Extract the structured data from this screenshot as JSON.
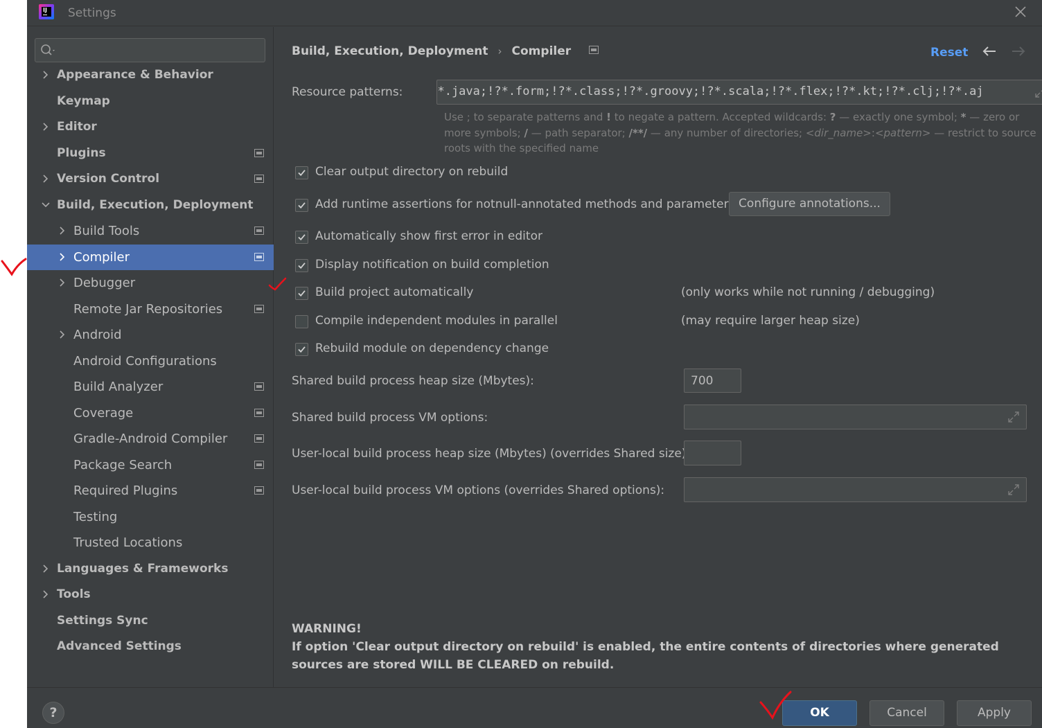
{
  "window": {
    "title": "Settings",
    "app_icon": "intellij-idea-icon",
    "app_icon_text": "IJ"
  },
  "sidebar": {
    "search": {
      "value": "",
      "placeholder": ""
    },
    "items": [
      {
        "label": "Appearance & Behavior",
        "bold": true,
        "expandable": true,
        "expanded": false,
        "project_icon": false
      },
      {
        "label": "Keymap",
        "bold": true,
        "expandable": false,
        "project_icon": false
      },
      {
        "label": "Editor",
        "bold": true,
        "expandable": true,
        "expanded": false,
        "project_icon": false
      },
      {
        "label": "Plugins",
        "bold": true,
        "expandable": false,
        "project_icon": true
      },
      {
        "label": "Version Control",
        "bold": true,
        "expandable": true,
        "expanded": false,
        "project_icon": true
      },
      {
        "label": "Build, Execution, Deployment",
        "bold": true,
        "expandable": true,
        "expanded": true,
        "project_icon": false
      },
      {
        "label": "Build Tools",
        "bold": false,
        "expandable": true,
        "expanded": false,
        "project_icon": true
      },
      {
        "label": "Compiler",
        "bold": false,
        "expandable": true,
        "expanded": false,
        "project_icon": true,
        "selected": true
      },
      {
        "label": "Debugger",
        "bold": false,
        "expandable": true,
        "expanded": false,
        "project_icon": false
      },
      {
        "label": "Remote Jar Repositories",
        "bold": false,
        "expandable": false,
        "project_icon": true
      },
      {
        "label": "Android",
        "bold": false,
        "expandable": true,
        "expanded": false,
        "project_icon": false
      },
      {
        "label": "Android Configurations",
        "bold": false,
        "expandable": false,
        "project_icon": false
      },
      {
        "label": "Build Analyzer",
        "bold": false,
        "expandable": false,
        "project_icon": true
      },
      {
        "label": "Coverage",
        "bold": false,
        "expandable": false,
        "project_icon": true
      },
      {
        "label": "Gradle-Android Compiler",
        "bold": false,
        "expandable": false,
        "project_icon": true
      },
      {
        "label": "Package Search",
        "bold": false,
        "expandable": false,
        "project_icon": true
      },
      {
        "label": "Required Plugins",
        "bold": false,
        "expandable": false,
        "project_icon": true
      },
      {
        "label": "Testing",
        "bold": false,
        "expandable": false,
        "project_icon": false
      },
      {
        "label": "Trusted Locations",
        "bold": false,
        "expandable": false,
        "project_icon": false
      },
      {
        "label": "Languages & Frameworks",
        "bold": true,
        "expandable": true,
        "expanded": false,
        "project_icon": false
      },
      {
        "label": "Tools",
        "bold": true,
        "expandable": true,
        "expanded": false,
        "project_icon": false
      },
      {
        "label": "Settings Sync",
        "bold": true,
        "expandable": false,
        "project_icon": false
      },
      {
        "label": "Advanced Settings",
        "bold": true,
        "expandable": false,
        "project_icon": false
      }
    ]
  },
  "header": {
    "breadcrumb": [
      "Build, Execution, Deployment",
      "Compiler"
    ],
    "breadcrumb_separator": "›",
    "reset_label": "Reset"
  },
  "compiler": {
    "resource_patterns_label": "Resource patterns:",
    "resource_patterns_value": "!?*.java;!?*.form;!?*.class;!?*.groovy;!?*.scala;!?*.flex;!?*.kt;!?*.clj;!?*.aj",
    "hint": {
      "line1a": "Use ; to separate patterns and ",
      "bang": "!",
      "line1b": " to negate a pattern. Accepted wildcards: ",
      "q": "?",
      "line1c": " — exactly one symbol; ",
      "star": "*",
      "line1d": " — zero or more symbols; ",
      "slash": "/",
      "line1e": " — path separator; ",
      "dstar": "/**/",
      "line1f": " — any number of directories; ",
      "dir": "<dir_name>",
      "colon": ":",
      "pat": "<pattern>",
      "line1g": " — restrict to source roots with the specified name"
    },
    "options": [
      {
        "label": "Clear output directory on rebuild",
        "checked": true,
        "note": ""
      },
      {
        "label": "Add runtime assertions for notnull-annotated methods and parameters",
        "checked": true,
        "note": ""
      },
      {
        "label": "Automatically show first error in editor",
        "checked": true,
        "note": ""
      },
      {
        "label": "Display notification on build completion",
        "checked": true,
        "note": ""
      },
      {
        "label": "Build project automatically",
        "checked": true,
        "note": "(only works while not running / debugging)"
      },
      {
        "label": "Compile independent modules in parallel",
        "checked": false,
        "note": "(may require larger heap size)"
      },
      {
        "label": "Rebuild module on dependency change",
        "checked": true,
        "note": ""
      }
    ],
    "configure_button": "Configure annotations...",
    "shared_heap_label": "Shared build process heap size (Mbytes):",
    "shared_heap_value": "700",
    "shared_vm_label": "Shared build process VM options:",
    "shared_vm_value": "",
    "user_heap_label": "User-local build process heap size (Mbytes) (overrides Shared size):",
    "user_heap_value": "",
    "user_vm_label": "User-local build process VM options (overrides Shared options):",
    "user_vm_value": "",
    "warning_title": "WARNING!",
    "warning_text": "If option 'Clear output directory on rebuild' is enabled, the entire contents of directories where generated sources are stored WILL BE CLEARED on rebuild."
  },
  "footer": {
    "help": "?",
    "ok": "OK",
    "cancel": "Cancel",
    "apply": "Apply"
  },
  "colors": {
    "background": "#3c3f41",
    "selection": "#4b6eaf",
    "link": "#589df6",
    "ok_button": "#365880",
    "annotation": "#e8121c"
  }
}
